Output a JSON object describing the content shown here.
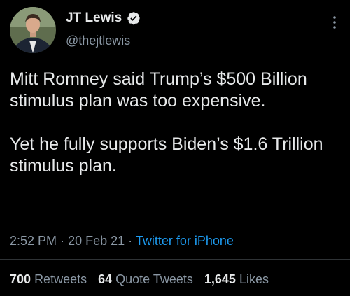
{
  "author": {
    "display_name": "JT Lewis",
    "handle": "@thejtlewis",
    "verified": true,
    "verified_icon": "verified-badge-icon"
  },
  "tweet": {
    "paragraphs": [
      "Mitt Romney said Trump’s $500 Billion stimulus plan was too expensive.",
      "Yet he fully supports Biden’s $1.6 Trillion stimulus plan."
    ],
    "time": "2:52 PM",
    "separator": "·",
    "date": "20 Feb 21",
    "source": "Twitter for iPhone"
  },
  "stats": {
    "retweets": {
      "count": "700",
      "label": "Retweets"
    },
    "quotes": {
      "count": "64",
      "label": "Quote Tweets"
    },
    "likes": {
      "count": "1,645",
      "label": "Likes"
    }
  },
  "colors": {
    "background": "#000000",
    "text": "#e7e9ea",
    "muted": "#8b98a5",
    "link": "#1d9bf0"
  }
}
